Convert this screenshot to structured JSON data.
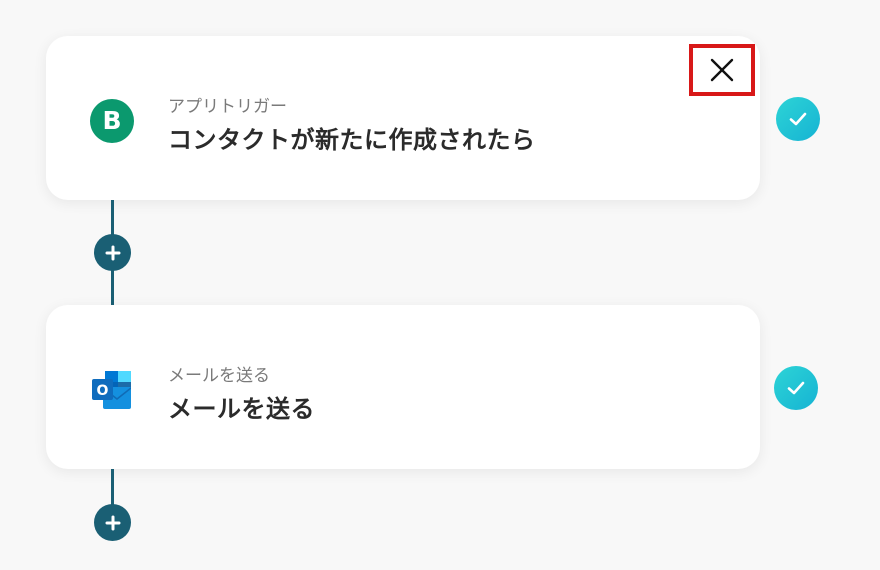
{
  "steps": [
    {
      "app_icon": "brevo-logo-icon",
      "app_icon_letter": "B",
      "subtitle": "アプリトリガー",
      "title": "コンタクトが新たに作成されたら",
      "status": "completed"
    },
    {
      "app_icon": "outlook-logo-icon",
      "app_icon_letter": "O",
      "subtitle": "メールを送る",
      "title": "メールを送る",
      "status": "completed"
    }
  ],
  "colors": {
    "connector": "#1a5f74",
    "check_gradient_start": "#2dd4d6",
    "check_gradient_end": "#16b3d3",
    "highlight_border": "#d81818",
    "brevo_green": "#0b996e",
    "outlook_blue": "#0f6cbd"
  }
}
